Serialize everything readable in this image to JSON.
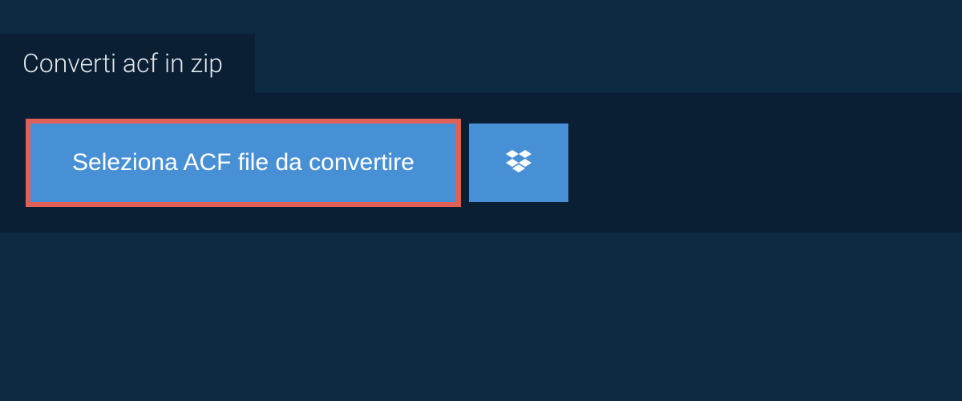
{
  "tab": {
    "title": "Converti acf in zip"
  },
  "main": {
    "select_button_label": "Seleziona ACF file da convertire"
  }
}
